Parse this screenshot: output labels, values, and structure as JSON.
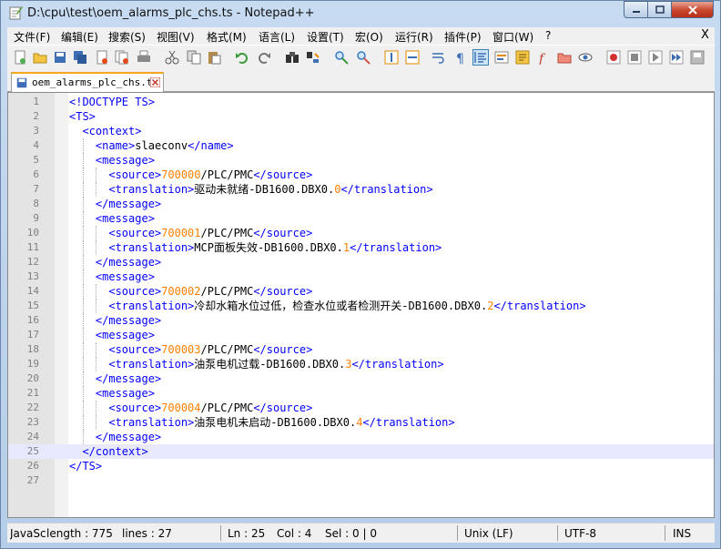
{
  "window": {
    "title": "D:\\cpu\\test\\oem_alarms_plc_chs.ts - Notepad++"
  },
  "menu": [
    "文件(F)",
    "编辑(E)",
    "搜索(S)",
    "视图(V)",
    "格式(M)",
    "语言(L)",
    "设置(T)",
    "宏(O)",
    "运行(R)",
    "插件(P)",
    "窗口(W)",
    "?"
  ],
  "menu_close": "X",
  "tab": {
    "label": "oem_alarms_plc_chs.ts"
  },
  "lines": [
    [
      {
        "c": "tag",
        "t": "<!DOCTYPE TS>"
      }
    ],
    [
      {
        "c": "tag",
        "t": "<TS>"
      }
    ],
    [
      {
        "c": "txt",
        "t": "  "
      },
      {
        "c": "tag",
        "t": "<context>"
      }
    ],
    [
      {
        "c": "txt",
        "t": "    "
      },
      {
        "c": "tag",
        "t": "<name>"
      },
      {
        "c": "txt",
        "t": "slaeconv"
      },
      {
        "c": "tag",
        "t": "</name>"
      }
    ],
    [
      {
        "c": "txt",
        "t": "    "
      },
      {
        "c": "tag",
        "t": "<message>"
      }
    ],
    [
      {
        "c": "txt",
        "t": "      "
      },
      {
        "c": "tag",
        "t": "<source>"
      },
      {
        "c": "num",
        "t": "700000"
      },
      {
        "c": "txt",
        "t": "/PLC/PMC"
      },
      {
        "c": "tag",
        "t": "</source>"
      }
    ],
    [
      {
        "c": "txt",
        "t": "      "
      },
      {
        "c": "tag",
        "t": "<translation>"
      },
      {
        "c": "txt",
        "t": "驱动未就绪-DB1600.DBX0."
      },
      {
        "c": "num",
        "t": "0"
      },
      {
        "c": "tag",
        "t": "</translation>"
      }
    ],
    [
      {
        "c": "txt",
        "t": "    "
      },
      {
        "c": "tag",
        "t": "</message>"
      }
    ],
    [
      {
        "c": "txt",
        "t": "    "
      },
      {
        "c": "tag",
        "t": "<message>"
      }
    ],
    [
      {
        "c": "txt",
        "t": "      "
      },
      {
        "c": "tag",
        "t": "<source>"
      },
      {
        "c": "num",
        "t": "700001"
      },
      {
        "c": "txt",
        "t": "/PLC/PMC"
      },
      {
        "c": "tag",
        "t": "</source>"
      }
    ],
    [
      {
        "c": "txt",
        "t": "      "
      },
      {
        "c": "tag",
        "t": "<translation>"
      },
      {
        "c": "txt",
        "t": "MCP面板失效-DB1600.DBX0."
      },
      {
        "c": "num",
        "t": "1"
      },
      {
        "c": "tag",
        "t": "</translation>"
      }
    ],
    [
      {
        "c": "txt",
        "t": "    "
      },
      {
        "c": "tag",
        "t": "</message>"
      }
    ],
    [
      {
        "c": "txt",
        "t": "    "
      },
      {
        "c": "tag",
        "t": "<message>"
      }
    ],
    [
      {
        "c": "txt",
        "t": "      "
      },
      {
        "c": "tag",
        "t": "<source>"
      },
      {
        "c": "num",
        "t": "700002"
      },
      {
        "c": "txt",
        "t": "/PLC/PMC"
      },
      {
        "c": "tag",
        "t": "</source>"
      }
    ],
    [
      {
        "c": "txt",
        "t": "      "
      },
      {
        "c": "tag",
        "t": "<translation>"
      },
      {
        "c": "txt",
        "t": "冷却水箱水位过低，检查水位或者检测开关-DB1600.DBX0."
      },
      {
        "c": "num",
        "t": "2"
      },
      {
        "c": "tag",
        "t": "</translation>"
      }
    ],
    [
      {
        "c": "txt",
        "t": "    "
      },
      {
        "c": "tag",
        "t": "</message>"
      }
    ],
    [
      {
        "c": "txt",
        "t": "    "
      },
      {
        "c": "tag",
        "t": "<message>"
      }
    ],
    [
      {
        "c": "txt",
        "t": "      "
      },
      {
        "c": "tag",
        "t": "<source>"
      },
      {
        "c": "num",
        "t": "700003"
      },
      {
        "c": "txt",
        "t": "/PLC/PMC"
      },
      {
        "c": "tag",
        "t": "</source>"
      }
    ],
    [
      {
        "c": "txt",
        "t": "      "
      },
      {
        "c": "tag",
        "t": "<translation>"
      },
      {
        "c": "txt",
        "t": "油泵电机过载-DB1600.DBX0."
      },
      {
        "c": "num",
        "t": "3"
      },
      {
        "c": "tag",
        "t": "</translation>"
      }
    ],
    [
      {
        "c": "txt",
        "t": "    "
      },
      {
        "c": "tag",
        "t": "</message>"
      }
    ],
    [
      {
        "c": "txt",
        "t": "    "
      },
      {
        "c": "tag",
        "t": "<message>"
      }
    ],
    [
      {
        "c": "txt",
        "t": "      "
      },
      {
        "c": "tag",
        "t": "<source>"
      },
      {
        "c": "num",
        "t": "700004"
      },
      {
        "c": "txt",
        "t": "/PLC/PMC"
      },
      {
        "c": "tag",
        "t": "</source>"
      }
    ],
    [
      {
        "c": "txt",
        "t": "      "
      },
      {
        "c": "tag",
        "t": "<translation>"
      },
      {
        "c": "txt",
        "t": "油泵电机未启动-DB1600.DBX0."
      },
      {
        "c": "num",
        "t": "4"
      },
      {
        "c": "tag",
        "t": "</translation>"
      }
    ],
    [
      {
        "c": "txt",
        "t": "    "
      },
      {
        "c": "tag",
        "t": "</message>"
      }
    ],
    [
      {
        "c": "txt",
        "t": "  "
      },
      {
        "c": "tag",
        "t": "</context>"
      }
    ],
    [
      {
        "c": "tag",
        "t": "</TS>"
      }
    ],
    []
  ],
  "current_line": 25,
  "status": {
    "filetype": "JavaSc",
    "length": "length : 775",
    "lines": "lines : 27",
    "ln": "Ln : 25",
    "col": "Col : 4",
    "sel": "Sel : 0 | 0",
    "eol": "Unix (LF)",
    "encoding": "UTF-8",
    "mode": "INS"
  },
  "colors": {
    "tag": "#0000ff",
    "number": "#ff8000",
    "text": "#000000",
    "current_line": "#e8e8ff",
    "tab_accent": "#f5a623"
  },
  "toolbar_icons": [
    "new-file-icon",
    "open-file-icon",
    "save-icon",
    "save-all-icon",
    "close-icon",
    "close-all-icon",
    "print-icon",
    "cut-icon",
    "copy-icon",
    "paste-icon",
    "undo-icon",
    "redo-icon",
    "find-icon",
    "replace-icon",
    "zoom-in-icon",
    "zoom-out-icon",
    "sync-vertical-icon",
    "sync-horizontal-icon",
    "word-wrap-icon",
    "show-all-chars-icon",
    "indent-guide-icon",
    "udl-icon",
    "doc-map-icon",
    "function-list-icon",
    "folder-workspace-icon",
    "monitoring-icon",
    "record-macro-icon",
    "stop-record-icon",
    "play-macro-icon",
    "run-macro-multiple-icon",
    "save-macro-icon"
  ]
}
